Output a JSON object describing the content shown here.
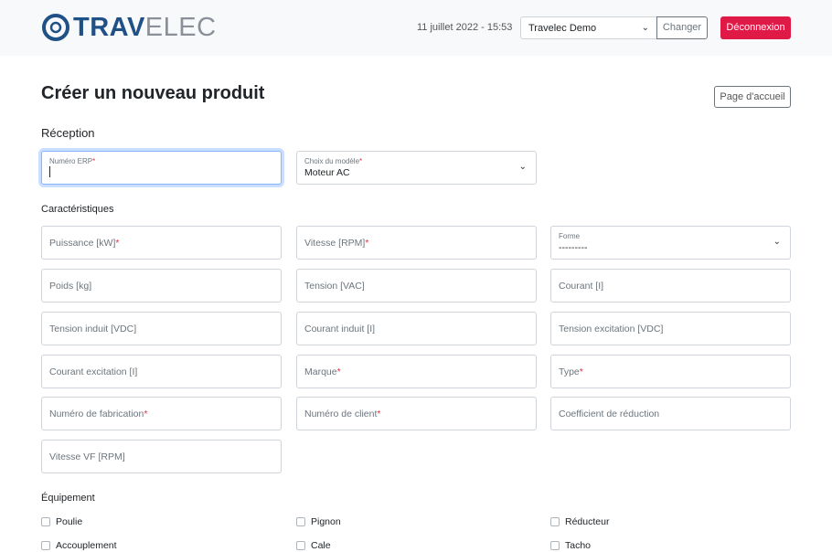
{
  "header": {
    "logo_primary": "TRAV",
    "logo_secondary": "ELEC",
    "datetime": "11 juillet 2022 - 15:53",
    "company_selected": "Travelec Demo",
    "change_label": "Changer",
    "logout_label": "Déconnexion"
  },
  "page": {
    "title": "Créer un nouveau produit",
    "home_label": "Page d'accueil"
  },
  "reception": {
    "heading": "Réception",
    "erp_label": "Numéro ERP",
    "erp_value": "",
    "model_label": "Choix du modèle",
    "model_value": "Moteur AC"
  },
  "characteristics": {
    "heading": "Caractéristiques",
    "fields": [
      {
        "label": "Puissance [kW]",
        "required": true
      },
      {
        "label": "Vitesse [RPM]",
        "required": true
      },
      {
        "label": "Forme",
        "required": false,
        "select": true,
        "value": "---------"
      },
      {
        "label": "Poids [kg]",
        "required": false
      },
      {
        "label": "Tension [VAC]",
        "required": false
      },
      {
        "label": "Courant [I]",
        "required": false
      },
      {
        "label": "Tension induit [VDC]",
        "required": false
      },
      {
        "label": "Courant induit [I]",
        "required": false
      },
      {
        "label": "Tension excitation [VDC]",
        "required": false
      },
      {
        "label": "Courant excitation [I]",
        "required": false
      },
      {
        "label": "Marque",
        "required": true
      },
      {
        "label": "Type",
        "required": true
      },
      {
        "label": "Numéro de fabrication",
        "required": true
      },
      {
        "label": "Numéro de client",
        "required": true
      },
      {
        "label": "Coefficient de réduction",
        "required": false
      },
      {
        "label": "Vitesse VF [RPM]",
        "required": false
      }
    ]
  },
  "equipment": {
    "heading": "Équipement",
    "items": [
      "Poulie",
      "Pignon",
      "Réducteur",
      "Accouplement",
      "Cale",
      "Tacho"
    ]
  },
  "required_mark": "*",
  "colors": {
    "accent": "#e01a46",
    "brand_blue": "#1f5186",
    "focus": "#86b7fe"
  }
}
